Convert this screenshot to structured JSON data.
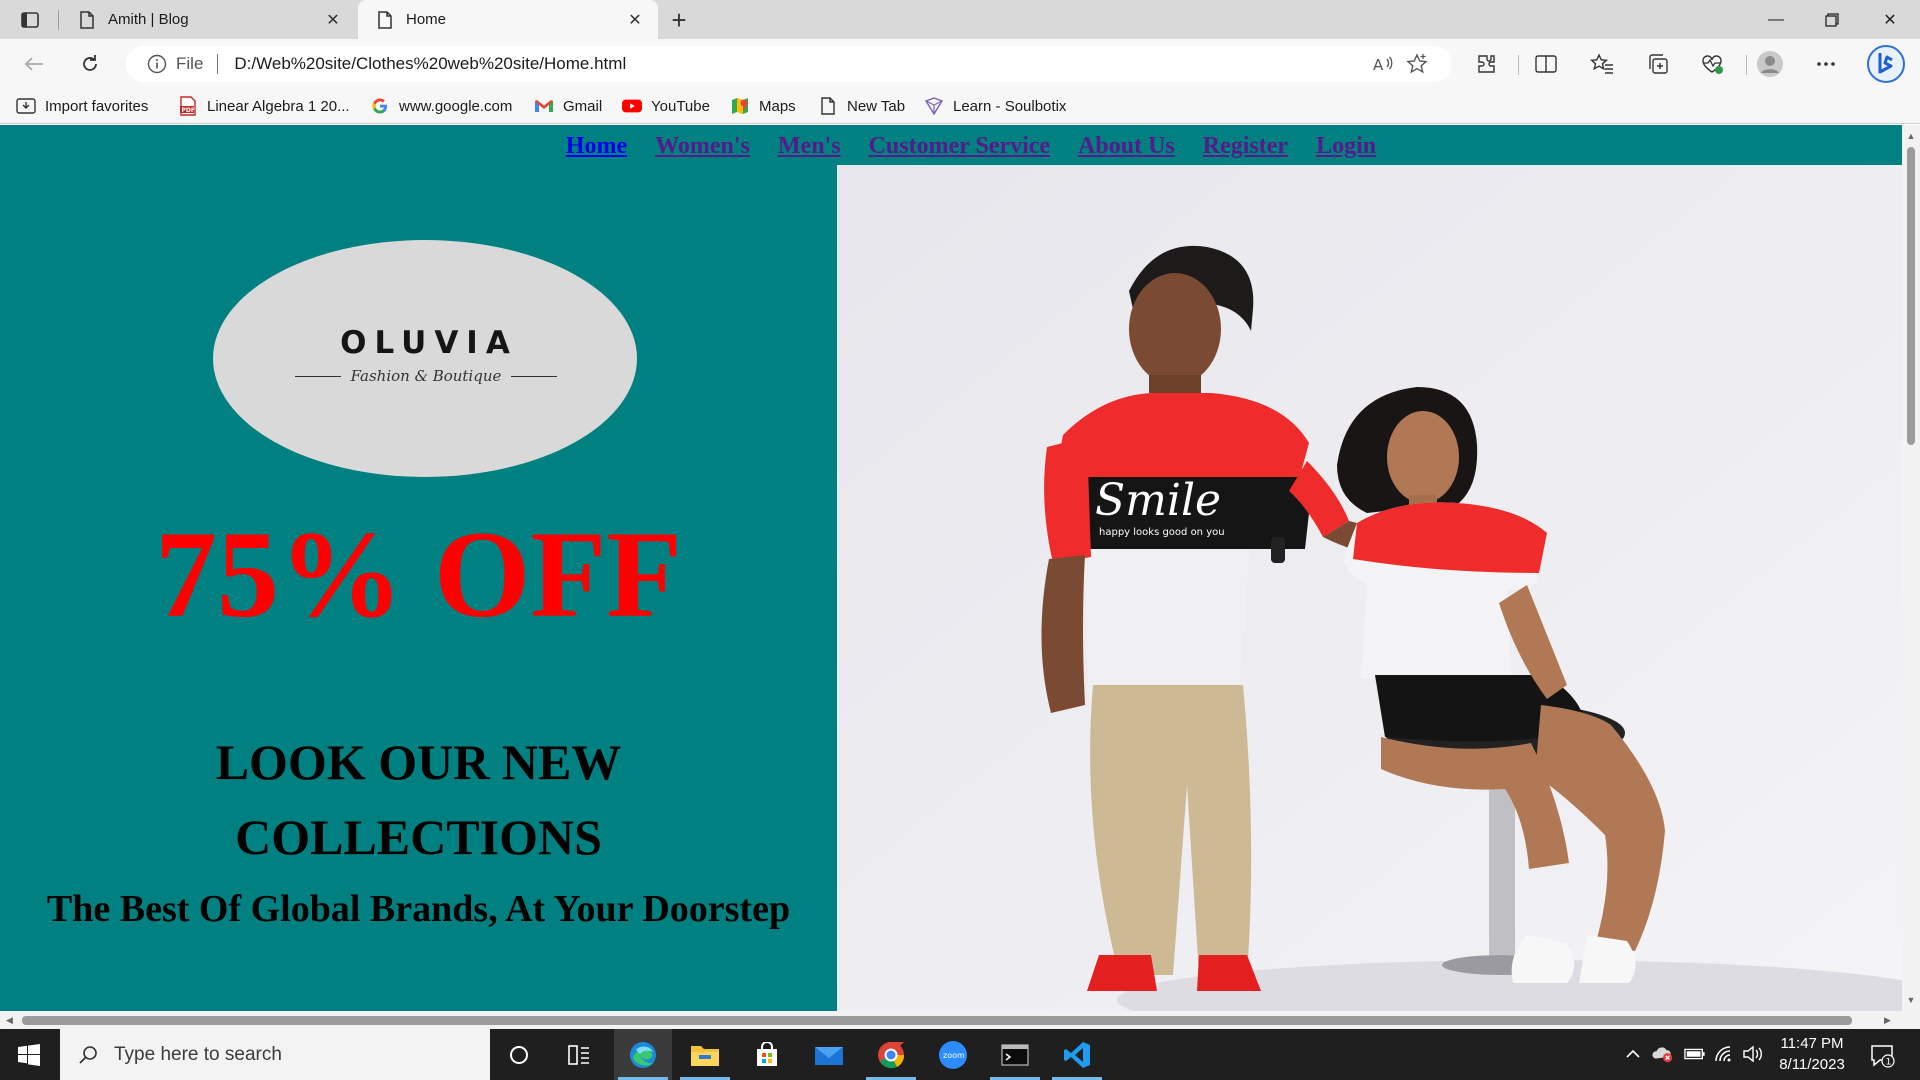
{
  "browser": {
    "tabs": [
      {
        "title": "Amith | Blog",
        "active": false
      },
      {
        "title": "Home",
        "active": true
      }
    ],
    "address": {
      "scheme_label": "File",
      "url": "D:/Web%20site/Clothes%20web%20site/Home.html"
    },
    "favorites": [
      {
        "label": "Import favorites",
        "icon": "import-icon"
      },
      {
        "label": "Linear Algebra 1 20...",
        "icon": "pdf-icon"
      },
      {
        "label": "www.google.com",
        "icon": "google-icon"
      },
      {
        "label": "Gmail",
        "icon": "gmail-icon"
      },
      {
        "label": "YouTube",
        "icon": "youtube-icon"
      },
      {
        "label": "Maps",
        "icon": "maps-icon"
      },
      {
        "label": "New Tab",
        "icon": "page-icon"
      },
      {
        "label": "Learn - Soulbotix",
        "icon": "soulbotix-icon"
      }
    ]
  },
  "site": {
    "nav": [
      {
        "label": "Home"
      },
      {
        "label": "Women's"
      },
      {
        "label": "Men's"
      },
      {
        "label": "Customer Service"
      },
      {
        "label": "About Us"
      },
      {
        "label": "Register"
      },
      {
        "label": "Login"
      }
    ],
    "logo": {
      "word": "OLUVIA",
      "tagline": "Fashion & Boutique"
    },
    "offer": "75% OFF",
    "headline_line1": "LOOK OUR NEW",
    "headline_line2": "COLLECTIONS",
    "tagline": "The Best Of Global Brands, At Your Doorstep",
    "hero_shirt_text": "Smile",
    "hero_shirt_subtext": "happy looks good on you"
  },
  "taskbar": {
    "search_placeholder": "Type here to search",
    "time": "11:47 PM",
    "date": "8/11/2023",
    "notification_count": "1"
  },
  "colors": {
    "site_background": "#008080",
    "offer": "#ff0000",
    "taskbar": "#1f1f1f"
  }
}
